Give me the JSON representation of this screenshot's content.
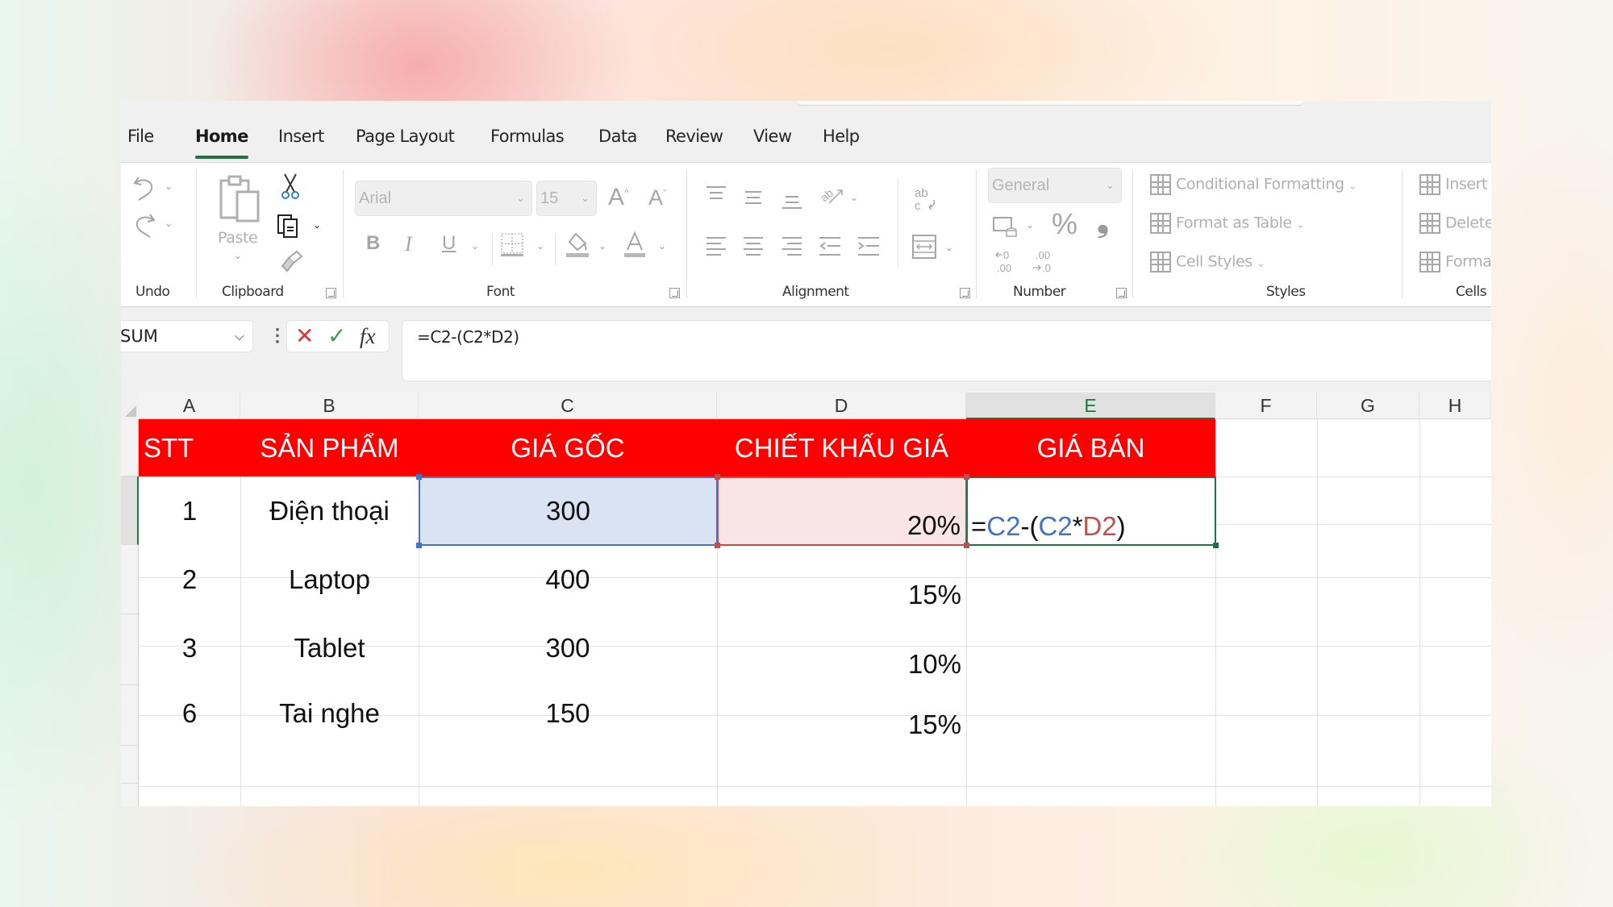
{
  "menu_tabs": [
    {
      "label": "File",
      "active": false
    },
    {
      "label": "Home",
      "active": true
    },
    {
      "label": "Insert",
      "active": false
    },
    {
      "label": "Page Layout",
      "active": false
    },
    {
      "label": "Formulas",
      "active": false
    },
    {
      "label": "Data",
      "active": false
    },
    {
      "label": "Review",
      "active": false
    },
    {
      "label": "View",
      "active": false
    },
    {
      "label": "Help",
      "active": false
    }
  ],
  "ribbon": {
    "groups": {
      "undo": "Undo",
      "clipboard": "Clipboard",
      "font": "Font",
      "alignment": "Alignment",
      "number": "Number",
      "styles": "Styles",
      "cells": "Cells"
    },
    "paste_label": "Paste",
    "font_name": "Arial",
    "font_size": "15",
    "number_format": "General",
    "bold": "B",
    "italic": "I",
    "underline": "U",
    "percent": "%",
    "comma": "❟",
    "styles": {
      "conditional_formatting": "Conditional Formatting",
      "format_as_table": "Format as Table",
      "cell_styles": "Cell Styles"
    },
    "cells": {
      "insert": "Insert",
      "delete": "Delete",
      "format": "Format"
    },
    "icons": {
      "undo": "undo-icon",
      "redo": "redo-icon",
      "cut": "scissors-icon",
      "copy": "copy-icon",
      "format_painter": "paintbrush-icon",
      "grow_font": "font-grow-icon",
      "shrink_font": "font-shrink-icon",
      "borders": "borders-icon",
      "fill": "fill-color-icon",
      "font_color": "font-color-icon",
      "wrap_text": "wrap-text-icon",
      "merge": "merge-center-icon",
      "orientation": "text-orientation-icon",
      "accounting": "accounting-format-icon",
      "increase_decimal": "increase-decimal-icon",
      "decrease_decimal": "decrease-decimal-icon"
    }
  },
  "formula_bar": {
    "name_box": "SUM",
    "cancel_symbol": "✕",
    "enter_symbol": "✓",
    "fx_label": "fx",
    "formula": "=C2-(C2*D2)"
  },
  "grid": {
    "columns": [
      "A",
      "B",
      "C",
      "D",
      "E",
      "F",
      "G",
      "H"
    ],
    "selected_column": "E",
    "header_row": [
      "STT",
      "SẢN PHẨM",
      "GIÁ GỐC",
      "CHIẾT KHẤU GIÁ",
      "GIÁ BÁN"
    ],
    "rows": [
      {
        "stt": "1",
        "product": "Điện thoại",
        "price": "300",
        "discount": "20%"
      },
      {
        "stt": "2",
        "product": "Laptop",
        "price": "400",
        "discount": "15%"
      },
      {
        "stt": "3",
        "product": "Tablet",
        "price": "300",
        "discount": "10%"
      },
      {
        "stt": "6",
        "product": "Tai nghe",
        "price": "150",
        "discount": "15%"
      }
    ],
    "editing_cell": {
      "ref": "E2",
      "parts": [
        {
          "text": "=",
          "color": "black"
        },
        {
          "text": "C2",
          "color": "blue"
        },
        {
          "text": "-(",
          "color": "black"
        },
        {
          "text": "C2",
          "color": "blue"
        },
        {
          "text": "*",
          "color": "black"
        },
        {
          "text": "D2",
          "color": "red"
        },
        {
          "text": ")",
          "color": "black"
        }
      ]
    }
  },
  "colors": {
    "header_fill": "#ff0000",
    "header_text": "#ffffff",
    "accent": "#217346",
    "ref_blue": "#4472c4",
    "ref_red": "#c0504d"
  }
}
